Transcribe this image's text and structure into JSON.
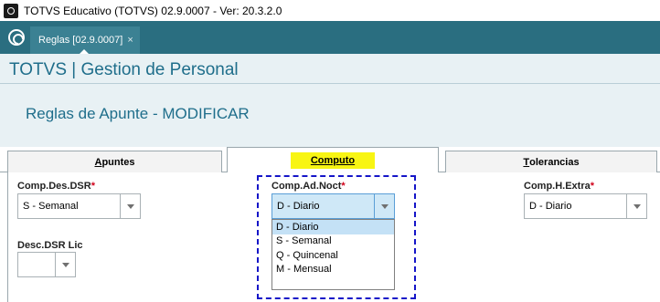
{
  "window": {
    "title": "TOTVS Educativo (TOTVS) 02.9.0007 - Ver: 20.3.2.0"
  },
  "tabbar": {
    "doc_tab_label": "Reglas [02.9.0007]",
    "close_glyph": "×"
  },
  "header": {
    "app_title": "TOTVS | Gestion de Personal",
    "page_title": "Reglas de Apunte - MODIFICAR"
  },
  "tabs": [
    {
      "label": "Apuntes",
      "underline_char": "A",
      "rest": "puntes",
      "active": false
    },
    {
      "label": "Computo",
      "underline_char": "C",
      "rest": "omputo",
      "active": true
    },
    {
      "label": "Tolerancias",
      "underline_char": "T",
      "rest": "olerancias",
      "active": false
    }
  ],
  "fields": {
    "comp_des_dsr": {
      "label": "Comp.Des.DSR",
      "required_mark": "*",
      "value": "S - Semanal"
    },
    "comp_ad_noct": {
      "label": "Comp.Ad.Noct",
      "required_mark": "*",
      "value": "D - Diario"
    },
    "comp_h_extra": {
      "label": "Comp.H.Extra",
      "required_mark": "*",
      "value": "D - Diario"
    },
    "desc_dsr_lic": {
      "label": "Desc.DSR Lic",
      "value": ""
    }
  },
  "dropdown": {
    "options": [
      "D - Diario",
      "S - Semanal",
      "Q - Quincenal",
      "M - Mensual"
    ],
    "selected_index": 0
  },
  "colors": {
    "tabbar_bg": "#2a6e80",
    "header_bg": "#e8f1f4",
    "title_blue": "#1f6e8b",
    "active_tab_highlight": "#f8f513",
    "required_red": "#d0021b",
    "focus_dash": "#1515c8"
  }
}
